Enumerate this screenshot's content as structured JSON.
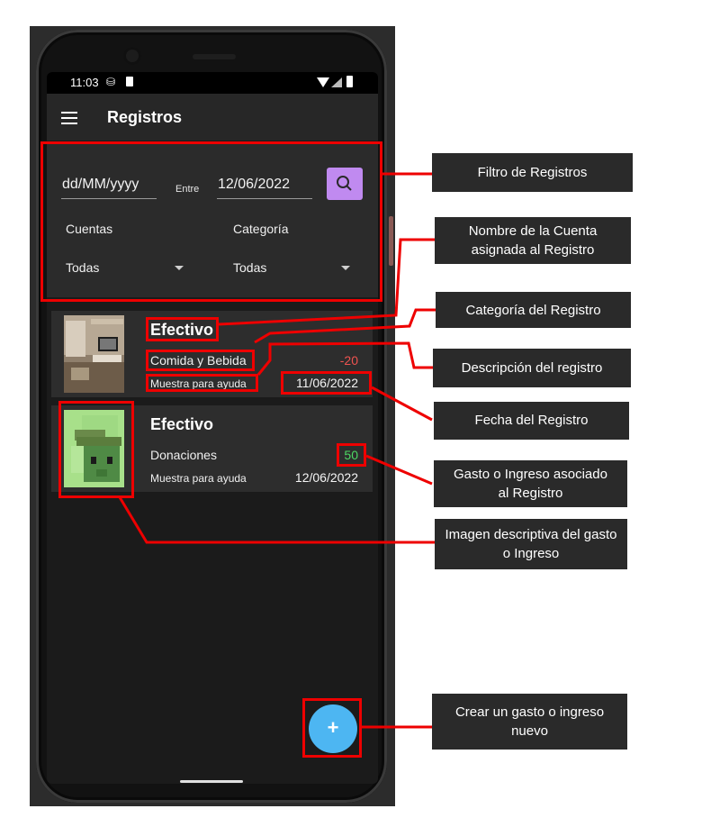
{
  "status_bar": {
    "time": "11:03",
    "sd_glyph": "⛁"
  },
  "app_bar": {
    "title": "Registros"
  },
  "filter": {
    "date_from_placeholder": "dd/MM/yyyy",
    "between_label": "Entre",
    "date_to_value": "12/06/2022",
    "accounts_label": "Cuentas",
    "accounts_value": "Todas",
    "category_label": "Categoría",
    "category_value": "Todas"
  },
  "records": [
    {
      "account": "Efectivo",
      "category": "Comida y Bebida",
      "amount": "-20",
      "amount_color": "#ef5350",
      "description": "Muestra para ayuda",
      "date": "11/06/2022",
      "image_icon": "room-photo"
    },
    {
      "account": "Efectivo",
      "category": "Donaciones",
      "amount": "50",
      "amount_color": "#4cd964",
      "description": "Muestra para ayuda",
      "date": "12/06/2022",
      "image_icon": "pixel-art-avatar"
    }
  ],
  "fab": {
    "label": "+"
  },
  "annotations": {
    "filter": "Filtro de Registros",
    "account_name": "Nombre de la Cuenta asignada al Registro",
    "category": "Categoría del Registro",
    "description": "Descripción del registro",
    "date": "Fecha del Registro",
    "amount": "Gasto o Ingreso asociado al Registro",
    "image": "Imagen descriptiva del gasto o Ingreso",
    "create": "Crear un gasto o ingreso nuevo"
  },
  "colors": {
    "highlight": "#ee0000",
    "search_button": "#c08af0",
    "fab": "#4db6f2"
  }
}
